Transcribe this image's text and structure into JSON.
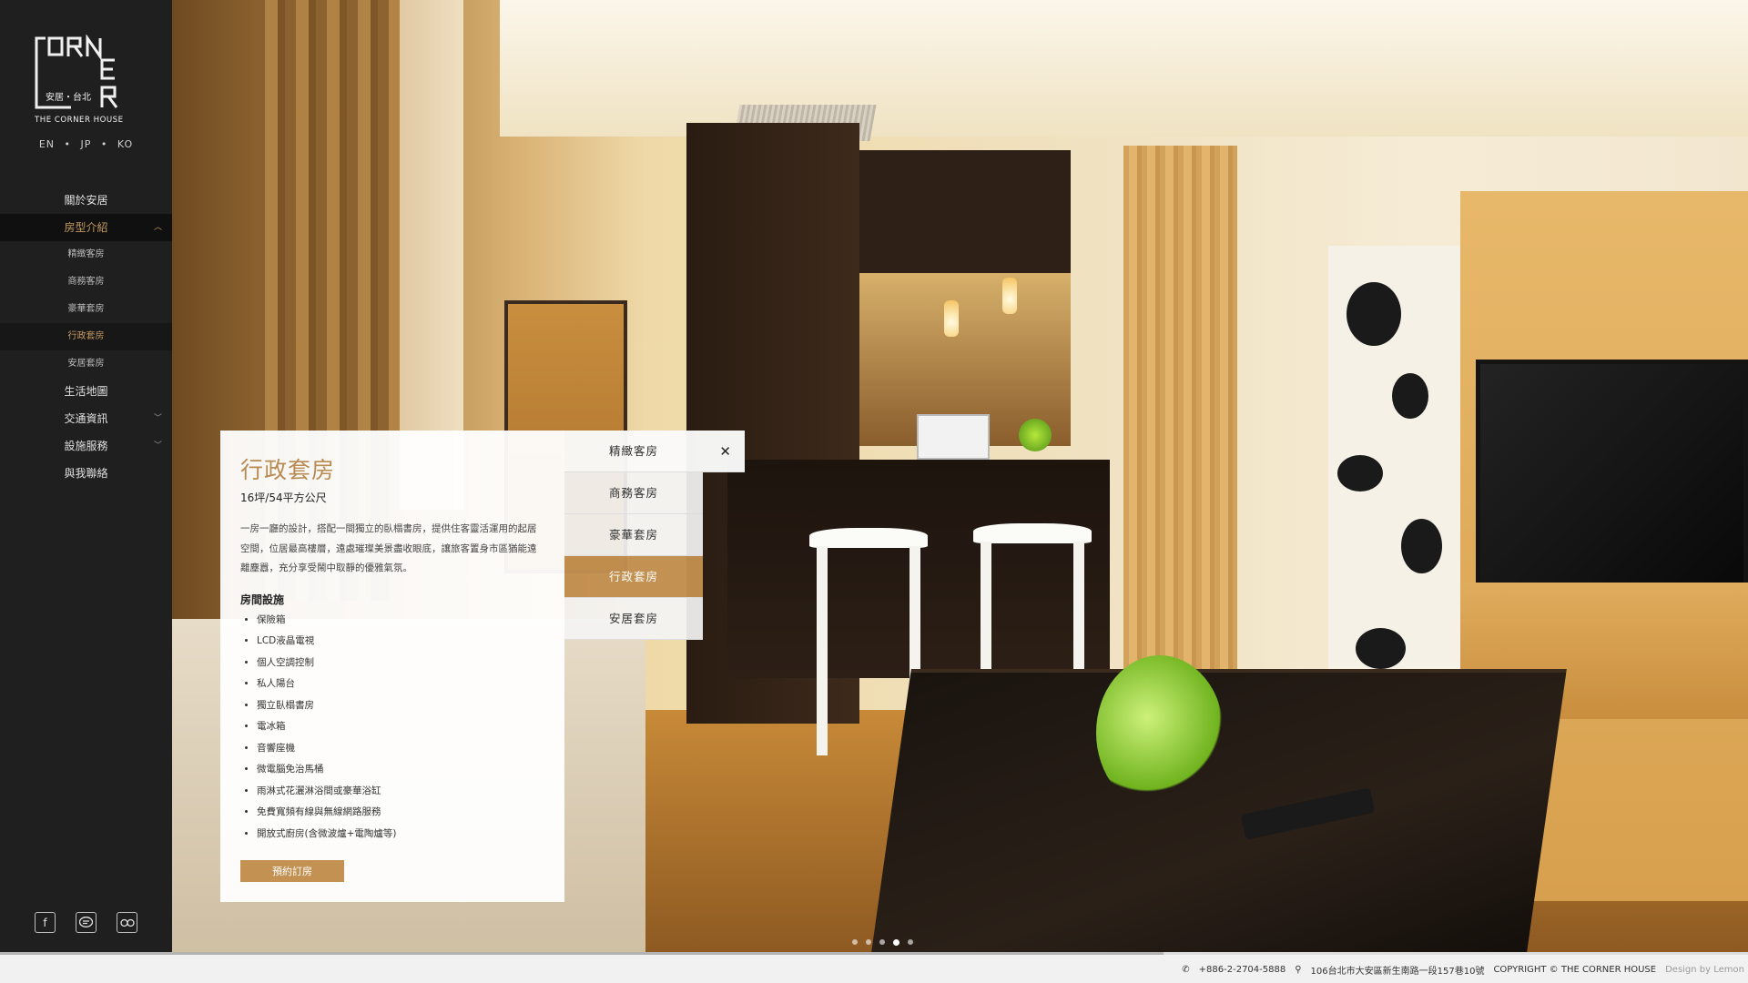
{
  "brand": {
    "logo_letters": "CORNER",
    "logo_chinese": "安居・台北",
    "logo_english": "THE CORNER HOUSE"
  },
  "languages": [
    "EN",
    "JP",
    "KO"
  ],
  "nav": {
    "items": [
      {
        "label": "關於安居",
        "expandable": false
      },
      {
        "label": "房型介紹",
        "expandable": true,
        "open": true
      },
      {
        "label": "生活地圖",
        "expandable": false
      },
      {
        "label": "交通資訊",
        "expandable": true
      },
      {
        "label": "設施服務",
        "expandable": true
      },
      {
        "label": "與我聯絡",
        "expandable": false
      }
    ],
    "room_submenu": [
      "精緻客房",
      "商務客房",
      "豪華套房",
      "行政套房",
      "安居套房"
    ],
    "active_sub": "行政套房"
  },
  "social": [
    "facebook-icon",
    "line-icon",
    "tripadvisor-icon"
  ],
  "room": {
    "title": "行政套房",
    "size": "16坪/54平方公尺",
    "description": "一房一廳的設計，搭配一間獨立的臥榻書房，提供住客靈活運用的起居空間，位居最高樓層，遠處璀璨美景盡收眼底，讓旅客置身市區猶能遠離塵囂，充分享受鬧中取靜的優雅氣氛。",
    "amenities_title": "房間設施",
    "amenities": [
      "保險箱",
      "LCD液晶電視",
      "個人空調控制",
      "私人陽台",
      "獨立臥榻書房",
      "電冰箱",
      "音響座機",
      "微電腦免治馬桶",
      "雨淋式花灑淋浴間或豪華浴缸",
      "免費寬頻有線與無線網路服務",
      "開放式廚房(含微波爐+電陶爐等)"
    ],
    "book_label": "預約訂房"
  },
  "room_tabs": [
    "精緻客房",
    "商務客房",
    "豪華套房",
    "行政套房",
    "安居套房"
  ],
  "active_tab_index": 3,
  "close_symbol": "✕",
  "slider": {
    "count": 5,
    "active_index": 3
  },
  "footer": {
    "phone": "+886-2-2704-5888",
    "address": "106台北市大安區新生南路一段157巷10號",
    "copyright": "COPYRIGHT © THE CORNER HOUSE",
    "credit": "Design by Lemon"
  },
  "colors": {
    "accent": "#c39152",
    "sidebar": "#1f1f1f",
    "footer": "#f1f1f1"
  }
}
